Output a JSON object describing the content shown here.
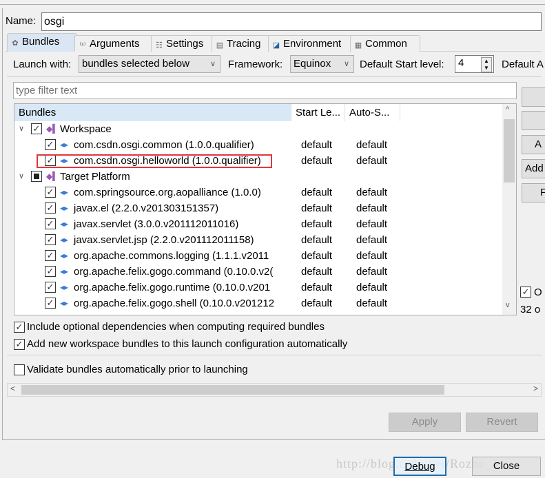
{
  "name_label": "Name:",
  "name_value": "osgi",
  "tabs": [
    {
      "label": "Bundles",
      "icon": "bundles-icon"
    },
    {
      "label": "Arguments",
      "icon": "arguments-icon"
    },
    {
      "label": "Settings",
      "icon": "settings-icon"
    },
    {
      "label": "Tracing",
      "icon": "tracing-icon"
    },
    {
      "label": "Environment",
      "icon": "environment-icon"
    },
    {
      "label": "Common",
      "icon": "common-icon"
    }
  ],
  "launch_with_label": "Launch with:",
  "launch_with_value": "bundles selected below",
  "framework_label": "Framework:",
  "framework_value": "Equinox",
  "start_level_label": "Default Start level:",
  "start_level_value": "4",
  "default_auto_label": "Default A",
  "filter_placeholder": "type filter text",
  "columns": [
    "Bundles",
    "Start Le...",
    "Auto-S..."
  ],
  "rows": [
    {
      "label": "Workspace",
      "level": 0,
      "group": true,
      "state": "checked",
      "start": "",
      "auto": ""
    },
    {
      "label": "com.csdn.osgi.common (1.0.0.qualifier)",
      "level": 1,
      "state": "checked",
      "start": "default",
      "auto": "default"
    },
    {
      "label": "com.csdn.osgi.helloworld (1.0.0.qualifier)",
      "level": 1,
      "state": "checked",
      "start": "default",
      "auto": "default",
      "highlighted": true
    },
    {
      "label": "Target Platform",
      "level": 0,
      "group": true,
      "state": "partial",
      "start": "",
      "auto": ""
    },
    {
      "label": "com.springsource.org.aopalliance (1.0.0)",
      "level": 1,
      "state": "checked",
      "start": "default",
      "auto": "default"
    },
    {
      "label": "javax.el (2.2.0.v201303151357)",
      "level": 1,
      "state": "checked",
      "start": "default",
      "auto": "default"
    },
    {
      "label": "javax.servlet (3.0.0.v201112011016)",
      "level": 1,
      "state": "checked",
      "start": "default",
      "auto": "default"
    },
    {
      "label": "javax.servlet.jsp (2.2.0.v201112011158)",
      "level": 1,
      "state": "checked",
      "start": "default",
      "auto": "default"
    },
    {
      "label": "org.apache.commons.logging (1.1.1.v2011",
      "level": 1,
      "state": "checked",
      "start": "default",
      "auto": "default"
    },
    {
      "label": "org.apache.felix.gogo.command (0.10.0.v2(",
      "level": 1,
      "state": "checked",
      "start": "default",
      "auto": "default"
    },
    {
      "label": "org.apache.felix.gogo.runtime (0.10.0.v201",
      "level": 1,
      "state": "checked",
      "start": "default",
      "auto": "default"
    },
    {
      "label": "org.apache.felix.gogo.shell (0.10.0.v201212",
      "level": 1,
      "state": "checked",
      "start": "default",
      "auto": "default"
    }
  ],
  "side_buttons": [
    "",
    "",
    "A",
    "Add",
    "F"
  ],
  "side_checkbox_label": "O",
  "side_count": "32 o",
  "options": [
    {
      "label": "Include optional dependencies when computing required bundles",
      "checked": true
    },
    {
      "label": "Add new workspace bundles to this launch configuration automatically",
      "checked": true
    },
    {
      "label": "Validate bundles automatically prior to launching",
      "checked": false
    }
  ],
  "apply_label": "Apply",
  "revert_label": "Revert",
  "debug_label": "Debug",
  "close_label": "Close",
  "watermark": "http://blog.csdn.net/Rozhe_J",
  "highlight_color": "#e0363c"
}
